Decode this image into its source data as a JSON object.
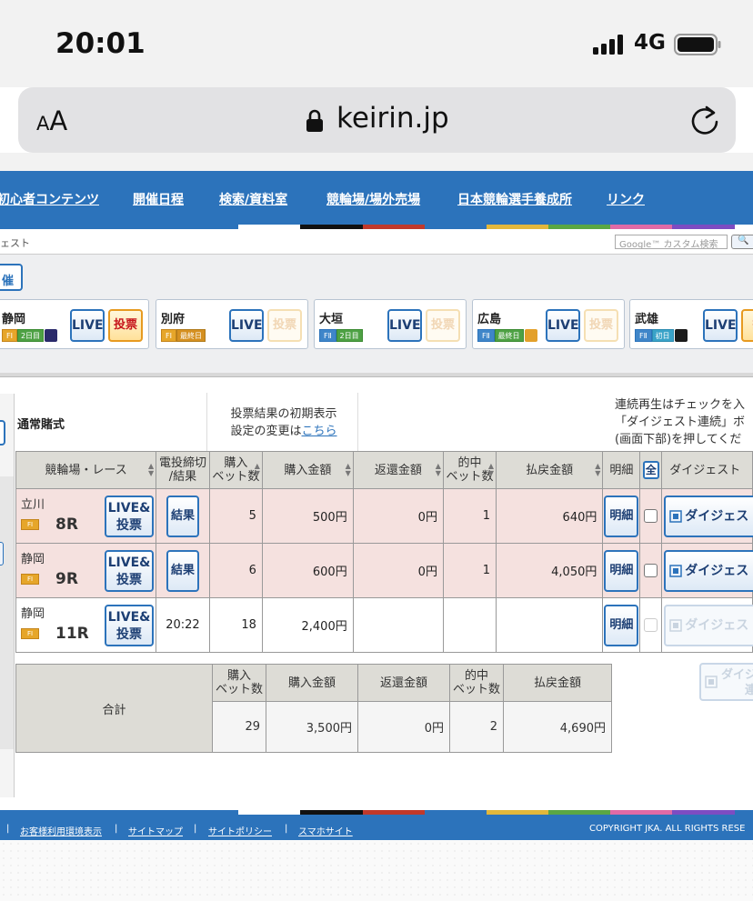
{
  "status_bar": {
    "time": "20:01",
    "network": "4G",
    "icons": [
      "signal-bars-icon",
      "battery-icon"
    ]
  },
  "browser": {
    "text_size": "AA",
    "url": "keirin.jp",
    "icons": [
      "lock-icon",
      "reload-icon"
    ]
  },
  "nav": {
    "items": [
      "初心者コンテンツ",
      "開催日程",
      "検索/資料室",
      "競輪場/場外売場",
      "日本競輪選手養成所",
      "リンク"
    ],
    "stripe_colors": [
      "#2c73bb",
      "#ffffff",
      "#111111",
      "#c0392b",
      "#2c73bb",
      "#e2b73b",
      "#5aa744",
      "#e06aa6",
      "#7d4cc2"
    ]
  },
  "breadcrumb": "ェスト",
  "search": {
    "placeholder": "Google™ カスタム検索",
    "button_label": "🔍"
  },
  "kaisai_label": "催",
  "venues": [
    {
      "name": "静岡",
      "grade": "FⅠ",
      "day": "2日目",
      "icon": "night-moon-icon",
      "live": "LIVE",
      "vote": "投票",
      "vote_enabled": true
    },
    {
      "name": "別府",
      "grade": "FⅠ",
      "day": "最終日",
      "icon": "",
      "live": "LIVE",
      "vote": "投票",
      "vote_enabled": false
    },
    {
      "name": "大垣",
      "grade": "FⅡ",
      "day": "2日目",
      "icon": "",
      "live": "LIVE",
      "vote": "投票",
      "vote_enabled": false
    },
    {
      "name": "広島",
      "grade": "FⅡ",
      "day": "最終日",
      "icon": "morning-icon",
      "live": "LIVE",
      "vote": "投票",
      "vote_enabled": false
    },
    {
      "name": "武雄",
      "grade": "FⅡ",
      "day": "初日",
      "icon": "midnight-icon",
      "live": "LIVE",
      "vote": "投",
      "vote_enabled": true
    }
  ],
  "bet_type": "通常賭式",
  "settings_note": {
    "line1": "投票結果の初期表示",
    "line2_prefix": "設定の変更は",
    "link": "こちら"
  },
  "digest_note": {
    "line1": "連続再生はチェックを入",
    "line2": "「ダイジェスト連続」ボ",
    "line3": "(画面下部)を押してくだ"
  },
  "table": {
    "headers": {
      "venue_race": "競輪場・レース",
      "deadline_1": "電投締切",
      "deadline_2": "/結果",
      "bets_1": "購入",
      "bets_2": "ベット数",
      "amount": "購入金額",
      "refund": "返還金額",
      "hits_1": "的中",
      "hits_2": "ベット数",
      "payout": "払戻金額",
      "detail": "明細",
      "all": "全",
      "digest": "ダイジェスト"
    },
    "rows": [
      {
        "venue": "立川",
        "grade": "FⅠ",
        "race": "8R",
        "live_1": "LIVE&",
        "live_2": "投票",
        "result": "結果",
        "deadline": "",
        "bets": "5",
        "amount": "500円",
        "refund": "0円",
        "hits": "1",
        "payout": "640円",
        "detail": "明細",
        "digest": "ダイジェス",
        "won": true
      },
      {
        "venue": "静岡",
        "grade": "FⅠ",
        "race": "9R",
        "live_1": "LIVE&",
        "live_2": "投票",
        "result": "結果",
        "deadline": "",
        "bets": "6",
        "amount": "600円",
        "refund": "0円",
        "hits": "1",
        "payout": "4,050円",
        "detail": "明細",
        "digest": "ダイジェス",
        "won": true
      },
      {
        "venue": "静岡",
        "grade": "FⅠ",
        "race": "11R",
        "live_1": "LIVE&",
        "live_2": "投票",
        "result": "",
        "deadline": "20:22",
        "bets": "18",
        "amount": "2,400円",
        "refund": "",
        "hits": "",
        "payout": "",
        "detail": "明細",
        "digest": "ダイジェス",
        "won": false
      }
    ]
  },
  "totals": {
    "label": "合計",
    "bets": "29",
    "amount": "3,500円",
    "refund": "0円",
    "hits": "2",
    "payout": "4,690円"
  },
  "digest_continuous": {
    "line1": "ダイジ",
    "line2": "連"
  },
  "footer": {
    "links": [
      "お客様利用環境表示",
      "サイトマップ",
      "サイトポリシー",
      "スマホサイト"
    ],
    "separator": "|",
    "copyright": "COPYRIGHT JKA. ALL RIGHTS RESE"
  }
}
